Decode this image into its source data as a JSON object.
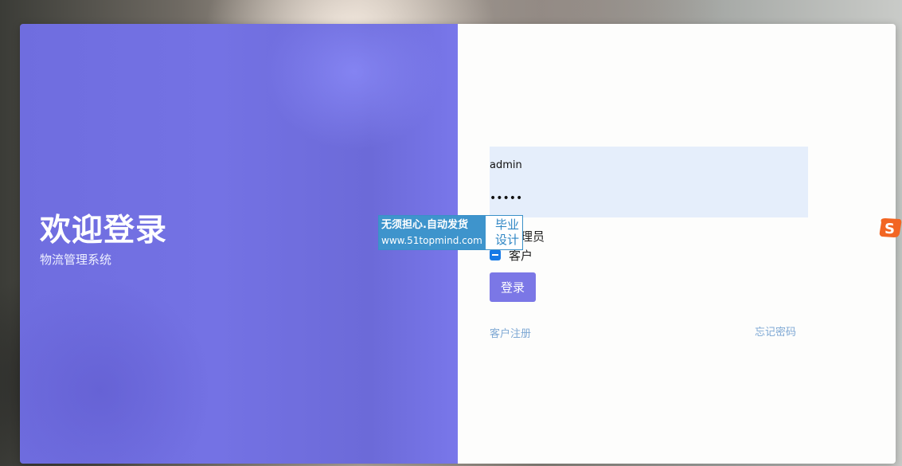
{
  "welcome": {
    "title": "欢迎登录",
    "subtitle": "物流管理系统"
  },
  "login_form": {
    "username_value": "admin",
    "password_value": "•••••",
    "roles": [
      {
        "label": "管理员",
        "checked": false
      },
      {
        "label": "客户",
        "checked": true
      }
    ],
    "submit_label": "登录",
    "register_link": "客户注册",
    "forgot_link": "忘记密码"
  },
  "watermark": {
    "line1": "无须担心.自动发货",
    "line2": "www.51topmind.com",
    "side": "毕业设计"
  },
  "sogou_ime_icon": {
    "letter": "S",
    "icon": "sogou-ime-icon"
  },
  "colors": {
    "left_panel": "#7472e4",
    "button": "#7b77e6",
    "field_bg": "#e5eefb",
    "link": "#7ea8d4",
    "checkbox": "#1679e6"
  }
}
